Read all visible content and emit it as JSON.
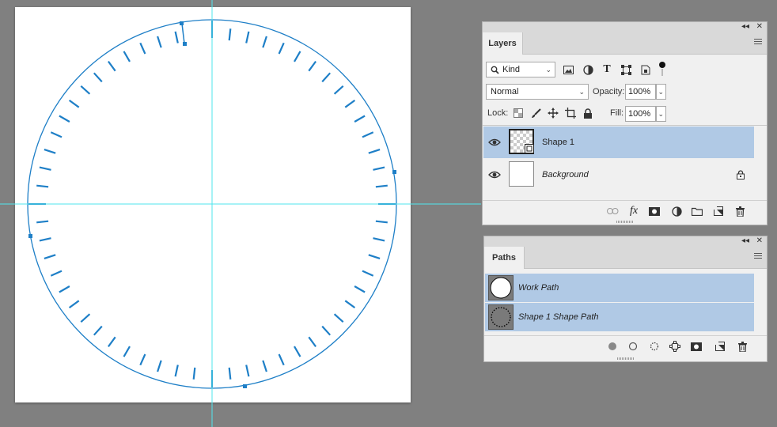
{
  "layers_panel": {
    "tab": "Layers",
    "collapse_glyph": "◂◂",
    "close_glyph": "✕",
    "filter": {
      "value": "Kind",
      "caret": "⌄"
    },
    "blend_mode": {
      "value": "Normal",
      "caret": "⌄"
    },
    "opacity": {
      "label": "Opacity:",
      "value": "100%",
      "caret": "⌄"
    },
    "lock_label": "Lock:",
    "fill": {
      "label": "Fill:",
      "value": "100%",
      "caret": "⌄"
    },
    "filter_icons": [
      "image-filter-icon",
      "adjustment-filter-icon",
      "type-filter-icon",
      "shape-filter-icon",
      "smart-object-filter-icon",
      "filter-toggle-icon"
    ],
    "lock_icons": [
      "lock-transparent-icon",
      "lock-image-icon",
      "lock-position-icon",
      "lock-artboard-icon",
      "lock-all-icon"
    ],
    "layers": [
      {
        "name": "Shape 1",
        "selected": true
      },
      {
        "name": "Background",
        "selected": false,
        "locked": true
      }
    ],
    "footer_icons": [
      "link-icon",
      "fx-icon",
      "mask-icon",
      "adjustment-icon",
      "folder-icon",
      "new-layer-icon",
      "trash-icon"
    ],
    "fx_text": "fx"
  },
  "paths_panel": {
    "tab": "Paths",
    "collapse_glyph": "◂◂",
    "close_glyph": "✕",
    "paths": [
      {
        "name": "Work Path"
      },
      {
        "name": "Shape 1 Shape Path"
      }
    ],
    "footer_icons": [
      "fill-path-icon",
      "stroke-path-icon",
      "load-selection-icon",
      "make-work-path-icon",
      "add-mask-icon",
      "new-path-icon",
      "trash-icon"
    ]
  },
  "canvas": {
    "background": "#ffffff",
    "path_color": "#1e7fc7",
    "guide_color": "#4fe6ee",
    "workspace_color": "#808080"
  },
  "colors": {
    "panel_bg": "#f0f0f0",
    "selection": "#b0c9e5"
  }
}
